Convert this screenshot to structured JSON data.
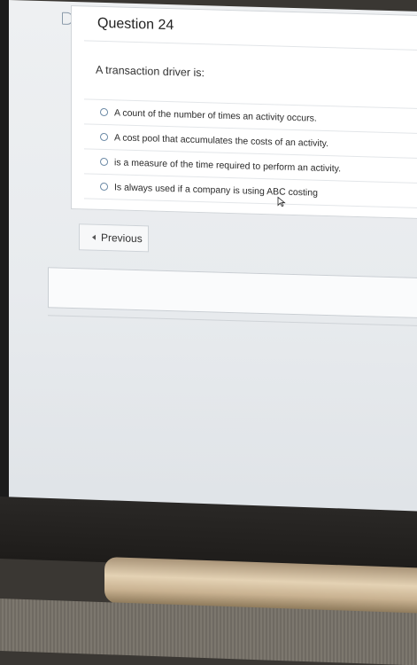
{
  "question": {
    "title": "Question 24",
    "prompt": "A transaction driver is:",
    "options": [
      {
        "label": "A count of the number of times an activity occurs."
      },
      {
        "label": "A cost pool that accumulates the costs of an activity."
      },
      {
        "label": "is a measure of the time required to perform an activity."
      },
      {
        "label": "Is always used if a company is using ABC costing"
      }
    ]
  },
  "navigation": {
    "previous_label": "Previous"
  },
  "icons": {
    "flag": "flag-icon",
    "previous": "chevron-left-icon",
    "cursor": "mouse-pointer-icon"
  },
  "colors": {
    "accent": "#6c8aa6"
  }
}
